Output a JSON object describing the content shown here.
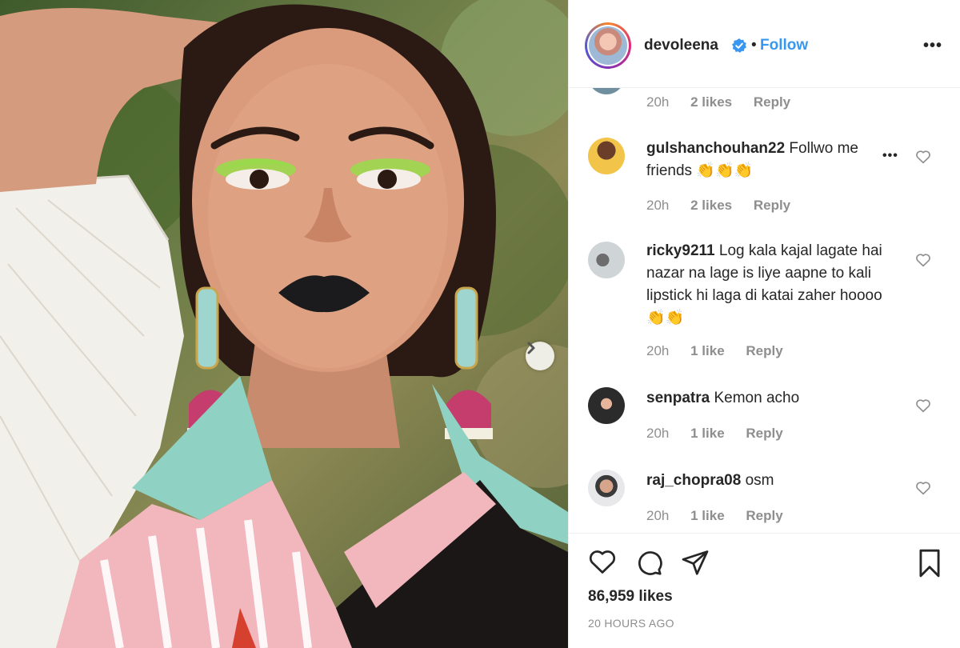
{
  "post": {
    "username": "devoleena",
    "follow_label": "Follow",
    "separator": "•",
    "more_label": "•••"
  },
  "comments": [
    {
      "user": "",
      "text": "",
      "time": "20h",
      "likes": "2 likes",
      "reply": "Reply"
    },
    {
      "user": "gulshanchouhan22",
      "text": "Follwo me friends 👏👏👏",
      "time": "20h",
      "likes": "2 likes",
      "reply": "Reply",
      "more": "•••"
    },
    {
      "user": "ricky9211",
      "text": "Log kala kajal lagate hai nazar na lage is liye aapne to kali lipstick hi laga di katai zaher hoooo👏👏",
      "time": "20h",
      "likes": "1 like",
      "reply": "Reply"
    },
    {
      "user": "senpatra",
      "text": "Kemon acho",
      "time": "20h",
      "likes": "1 like",
      "reply": "Reply"
    },
    {
      "user": "raj_chopra08",
      "text": "osm",
      "time": "20h",
      "likes": "1 like",
      "reply": "Reply"
    }
  ],
  "footer": {
    "likes": "86,959 likes",
    "time_ago": "20 HOURS AGO"
  },
  "icons": [
    "verified-icon",
    "heart-icon",
    "comment-icon",
    "share-icon",
    "bookmark-icon",
    "next-arrow-icon"
  ],
  "colors": {
    "link": "#3897f0",
    "verified": "#3897f0",
    "muted": "#8e8e8e",
    "text": "#262626"
  }
}
